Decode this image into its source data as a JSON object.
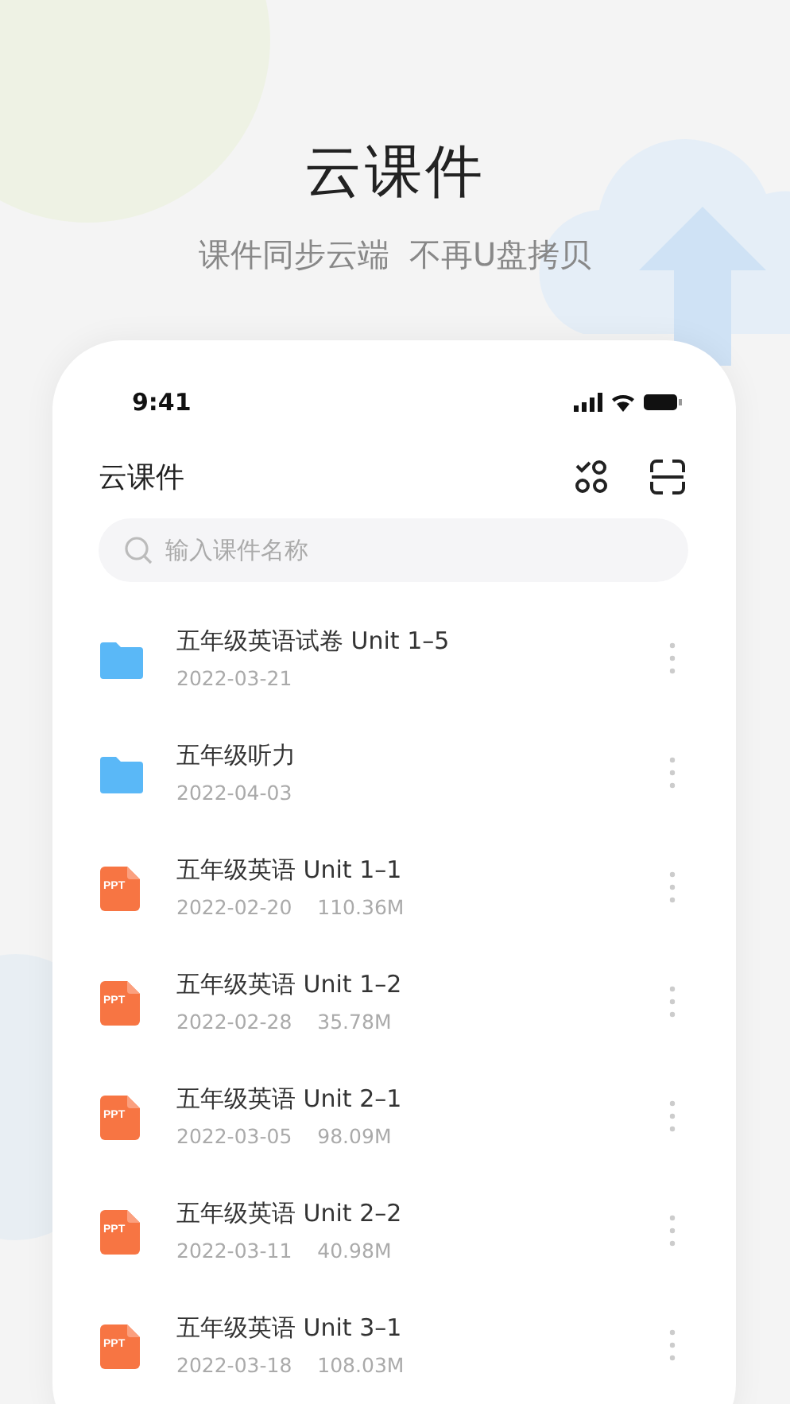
{
  "promo": {
    "headline": "云课件",
    "tagline": "课件同步云端  不再U盘拷贝"
  },
  "status_bar": {
    "time": "9:41"
  },
  "header": {
    "title": "云课件"
  },
  "search": {
    "placeholder": "输入课件名称"
  },
  "files": [
    {
      "kind": "folder",
      "name": "五年级英语试卷 Unit 1–5",
      "date": "2022-03-21"
    },
    {
      "kind": "folder",
      "name": "五年级听力",
      "date": "2022-04-03"
    },
    {
      "kind": "ppt",
      "badge": "PPT",
      "name": "五年级英语 Unit 1–1",
      "date": "2022-02-20",
      "size": "110.36M"
    },
    {
      "kind": "ppt",
      "badge": "PPT",
      "name": "五年级英语 Unit 1–2",
      "date": "2022-02-28",
      "size": "35.78M"
    },
    {
      "kind": "ppt",
      "badge": "PPT",
      "name": "五年级英语 Unit 2–1",
      "date": "2022-03-05",
      "size": "98.09M"
    },
    {
      "kind": "ppt",
      "badge": "PPT",
      "name": "五年级英语 Unit 2–2",
      "date": "2022-03-11",
      "size": "40.98M"
    },
    {
      "kind": "ppt",
      "badge": "PPT",
      "name": "五年级英语 Unit 3–1",
      "date": "2022-03-18",
      "size": "108.03M"
    }
  ]
}
